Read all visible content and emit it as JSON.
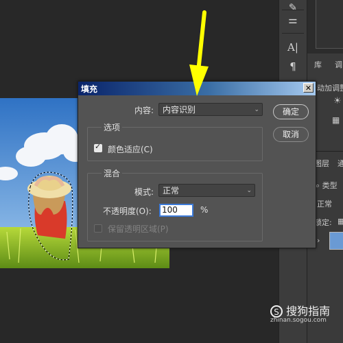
{
  "dialog": {
    "title": "填充",
    "close_glyph": "✕",
    "content_label": "内容:",
    "content_value": "内容识别",
    "options_group": "选项",
    "color_adapt_label": "颜色适应(C)",
    "color_adapt_checked": true,
    "blend_group": "混合",
    "mode_label": "模式:",
    "mode_value": "正常",
    "opacity_label": "不透明度(O):",
    "opacity_value": "100",
    "opacity_unit": "%",
    "preserve_label": "保留透明区域(P)",
    "preserve_checked": false,
    "ok_label": "确定",
    "cancel_label": "取消"
  },
  "right_panel": {
    "tab_library": "库",
    "tab_adjust": "调",
    "adjust_text": "动加调整",
    "tab_layers": "图层",
    "tab_channels": "通",
    "filter_label": "类型",
    "blend_mode": "正常",
    "lock_label": "锁定:"
  },
  "watermark": {
    "brand": "搜狗指南",
    "url": "zhinan.sogou.com"
  },
  "colors": {
    "arrow": "#ffff00",
    "dialog_bg": "#535353",
    "titlebar_start": "#0a246a",
    "titlebar_end": "#a6caf0",
    "focus": "#3d7bd9"
  }
}
